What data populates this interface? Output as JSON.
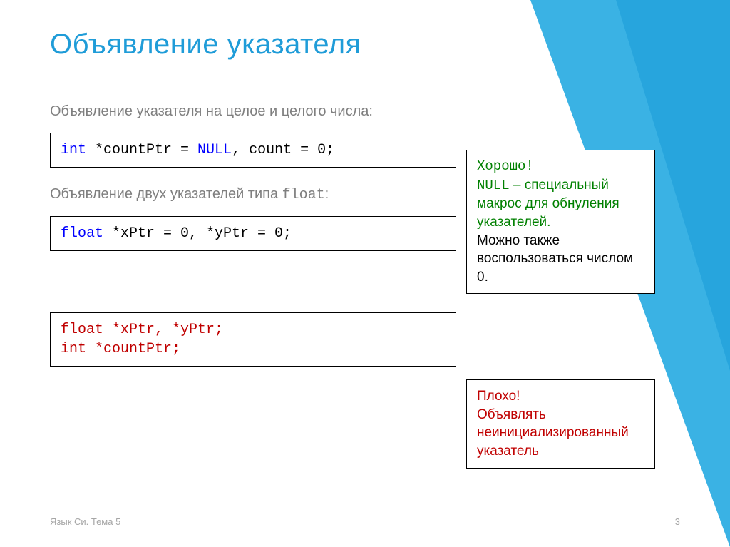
{
  "title": "Объявление указателя",
  "text1": "Объявление указателя на целое и целого числа:",
  "code1": {
    "kw1": "int",
    "seg1": " *countPtr = ",
    "null": "NULL",
    "seg2": ", count = 0;"
  },
  "text2_a": "Объявление двух указателей типа ",
  "text2_mono": "float",
  "text2_b": ":",
  "code2": {
    "kw1": "float",
    "seg1": " *xPtr = 0, *yPtr = 0;"
  },
  "code3": {
    "line1_kw": "float",
    "line1_rest": " *xPtr, *yPtr;",
    "line2_kw": "int",
    "line2_rest": " *countPtr;"
  },
  "good": {
    "l1": "Хорошо!",
    "l2a": "NULL",
    "l2b": " – специальный макрос для обнуления указателей.",
    "l3": "Можно также воспользоваться числом 0."
  },
  "bad": {
    "l1": "Плохо!",
    "l2": "Объявлять неинициализированный указатель"
  },
  "footer_left": "Язык Си. Тема 5",
  "footer_right": "3"
}
